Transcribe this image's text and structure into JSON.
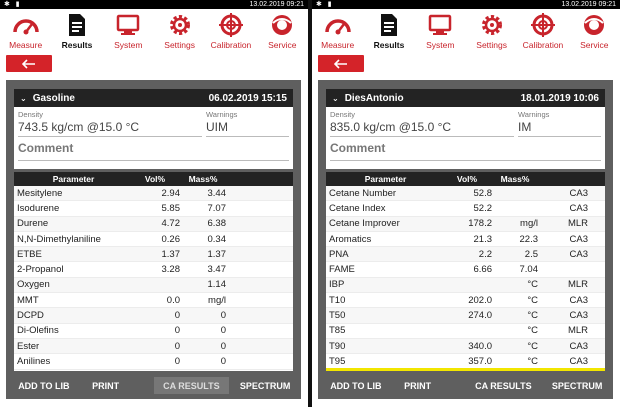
{
  "colors": {
    "accent": "#d42329",
    "dark_header": "#232323",
    "frame": "#5f5f5f",
    "highlight": "#f2e600"
  },
  "nav": [
    {
      "label": "Measure",
      "icon": "gauge-icon"
    },
    {
      "label": "Results",
      "icon": "document-icon"
    },
    {
      "label": "System",
      "icon": "computer-icon"
    },
    {
      "label": "Settings",
      "icon": "gear-icon"
    },
    {
      "label": "Calibration",
      "icon": "crosshair-icon"
    },
    {
      "label": "Service",
      "icon": "service-icon"
    }
  ],
  "panels": [
    {
      "status_time": "13.02.2019 09:21",
      "sample_name": "Gasoline",
      "date": "06.02.2019 15:15",
      "density_label": "Density",
      "density_value": "743.5 kg/cm @15.0 °C",
      "warnings_label": "Warnings",
      "warnings_value": "UIM",
      "comment_label": "Comment",
      "columns": [
        "Parameter",
        "Vol%",
        "Mass%",
        ""
      ],
      "rows": [
        [
          "Mesitylene",
          "2.94",
          "3.44",
          ""
        ],
        [
          "Isodurene",
          "5.85",
          "7.07",
          ""
        ],
        [
          "Durene",
          "4.72",
          "6.38",
          ""
        ],
        [
          "N,N-Dimethylaniline",
          "0.26",
          "0.34",
          ""
        ],
        [
          "ETBE",
          "1.37",
          "1.37",
          ""
        ],
        [
          "2-Propanol",
          "3.28",
          "3.47",
          ""
        ],
        [
          "Oxygen",
          "",
          "1.14",
          ""
        ],
        [
          "MMT",
          "0.0",
          "mg/l",
          ""
        ],
        [
          "DCPD",
          "0",
          "0",
          ""
        ],
        [
          "Di-Olefins",
          "0",
          "0",
          ""
        ],
        [
          "Ester",
          "0",
          "0",
          ""
        ],
        [
          "Anilines",
          "0",
          "0",
          ""
        ]
      ],
      "buttons": [
        {
          "label": "ADD TO LIB",
          "state": "normal"
        },
        {
          "label": "PRINT",
          "state": "normal"
        },
        {
          "label": "CA RESULTS",
          "state": "disabled"
        },
        {
          "label": "SPECTRUM",
          "state": "normal"
        }
      ],
      "highlight": false
    },
    {
      "status_time": "13.02.2019 09:21",
      "sample_name": "DiesAntonio",
      "date": "18.01.2019 10:06",
      "density_label": "Density",
      "density_value": "835.0 kg/cm @15.0 °C",
      "warnings_label": "Warnings",
      "warnings_value": "IM",
      "comment_label": "Comment",
      "columns": [
        "Parameter",
        "Vol%",
        "Mass%",
        ""
      ],
      "rows": [
        [
          "Cetane Number",
          "52.8",
          "",
          "CA3"
        ],
        [
          "Cetane Index",
          "52.2",
          "",
          "CA3"
        ],
        [
          "Cetane Improver",
          "178.2",
          "mg/l",
          "MLR"
        ],
        [
          "Aromatics",
          "21.3",
          "22.3",
          "CA3"
        ],
        [
          "PNA",
          "2.2",
          "2.5",
          "CA3"
        ],
        [
          "FAME",
          "6.66",
          "7.04",
          ""
        ],
        [
          "IBP",
          "",
          "°C",
          "MLR"
        ],
        [
          "T10",
          "202.0",
          "°C",
          "CA3"
        ],
        [
          "T50",
          "274.0",
          "°C",
          "CA3"
        ],
        [
          "T85",
          "",
          "°C",
          "MLR"
        ],
        [
          "T90",
          "340.0",
          "°C",
          "CA3"
        ],
        [
          "T95",
          "357.0",
          "°C",
          "CA3"
        ]
      ],
      "buttons": [
        {
          "label": "ADD TO LIB",
          "state": "normal"
        },
        {
          "label": "PRINT",
          "state": "normal"
        },
        {
          "label": "CA RESULTS",
          "state": "normal"
        },
        {
          "label": "SPECTRUM",
          "state": "normal"
        }
      ],
      "highlight": true
    }
  ]
}
